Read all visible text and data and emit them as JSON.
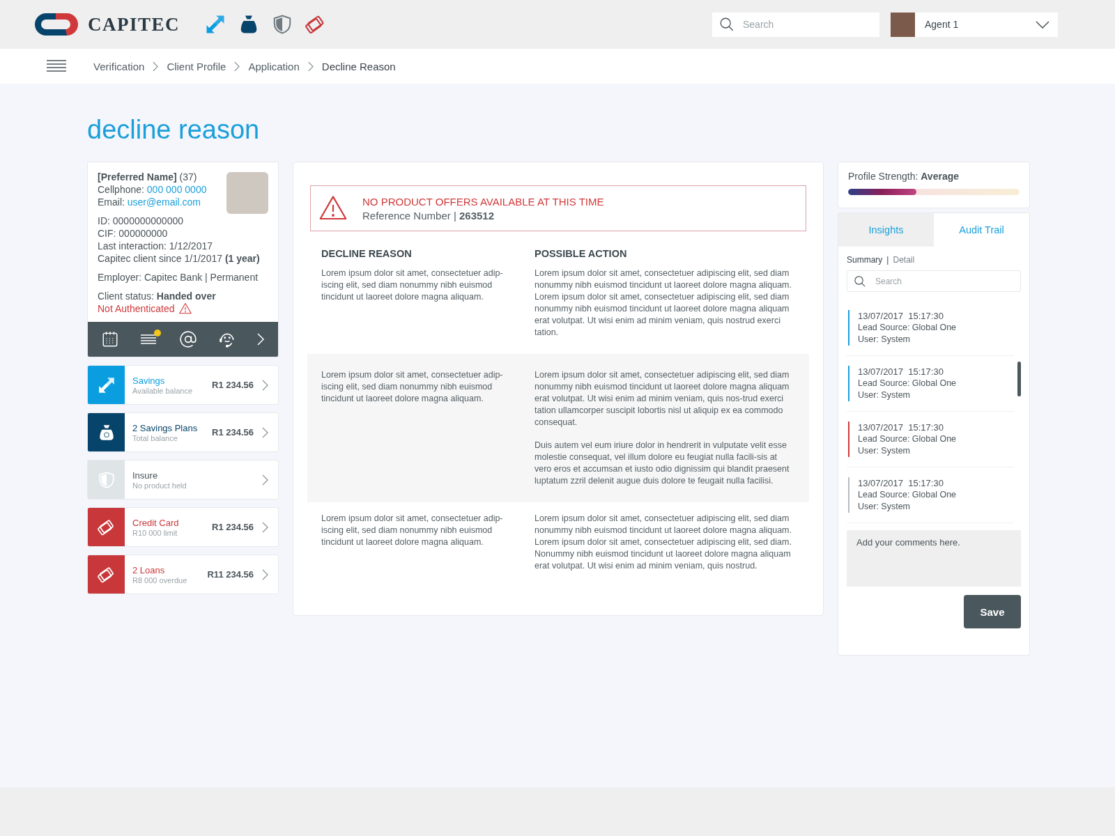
{
  "header": {
    "brand": "CAPITEC",
    "search": {
      "placeholder": "Search"
    },
    "user": {
      "name": "Agent 1"
    }
  },
  "header_icons": [
    {
      "kind": "transfer"
    },
    {
      "kind": "bag"
    },
    {
      "kind": "shield"
    },
    {
      "kind": "card"
    }
  ],
  "breadcrumb": [
    "Verification",
    "Client Profile",
    "Application",
    "Decline Reason"
  ],
  "title": "decline reason",
  "client": {
    "name_line": "**[Preferred Name]** (37)",
    "cellphone_label": "Cellphone:",
    "cellphone": "000 000 0000",
    "email_label": "Email:",
    "email": "user@email.com",
    "details": [
      "ID: 0000000000000",
      "CIF: 000000000",
      "Last interaction: 1/12/2017",
      "Capitec client since 1/1/2017 **(1 year)**"
    ],
    "employer": "Employer: Capitec Bank | Permanent",
    "status": "Client status: **Handed over**",
    "auth": "Not Authenticated"
  },
  "client_actions": [
    {
      "kind": "calendar",
      "alert": false
    },
    {
      "kind": "notes",
      "alert": true
    },
    {
      "kind": "email",
      "alert": false
    },
    {
      "kind": "support",
      "alert": false
    },
    {
      "kind": "more",
      "alert": false
    }
  ],
  "products": [
    {
      "kind": "transfer",
      "title": "Savings",
      "subtitle": "Available balance",
      "amount": "R1 234.56",
      "color": "#0a9ee0",
      "held": true
    },
    {
      "kind": "bag",
      "title": "2 Savings Plans",
      "subtitle": "Total balance",
      "amount": "R1 234.56",
      "color": "#07446b",
      "held": true
    },
    {
      "kind": "shield",
      "title": "Insure",
      "subtitle": "No product held",
      "color": "#dfe4e7",
      "held": false
    },
    {
      "kind": "card",
      "title": "Credit Card",
      "subtitle": "R10 000 limit",
      "amount": "R1 234.56",
      "color": "#c8373a",
      "held": true
    },
    {
      "kind": "card",
      "title": "2 Loans",
      "subtitle": "R8 000 overdue",
      "amount": "R11 234.56",
      "color": "#c8373a",
      "held": true
    }
  ],
  "alert": {
    "title": "NO PRODUCT OFFERS AVAILABLE AT THIS TIME",
    "reference": "Reference Number | **263512**"
  },
  "columns": [
    "DECLINE REASON",
    "POSSIBLE ACTION"
  ],
  "rows": [
    {
      "shaded": false,
      "reason": "Lorem ipsum dolor sit amet, consectetuer adip-iscing elit, sed diam nonummy nibh euismod tincidunt ut laoreet dolore magna aliquam.",
      "actions": [
        "Lorem ipsum dolor sit amet, consectetuer adipiscing elit, sed diam nonummy nibh euismod tincidunt ut laoreet dolore magna aliquam. Lorem ipsum dolor sit amet, consectetuer adipiscing elit, sed diam nonummy nibh euismod tincidunt ut laoreet dolore magna aliquam erat volutpat. Ut wisi enim ad minim veniam, quis nostrud exerci tation."
      ]
    },
    {
      "shaded": true,
      "reason": "Lorem ipsum dolor sit amet, consectetuer adip-iscing elit, sed diam nonummy nibh euismod tincidunt ut laoreet dolore magna aliquam.",
      "actions": [
        "Lorem ipsum dolor sit amet, consectetuer adipiscing elit, sed diam nonummy nibh euismod tincidunt ut laoreet dolore magna aliquam erat volutpat. Ut wisi enim ad minim veniam, quis nos-trud exerci tation ullamcorper suscipit lobortis nisl ut aliquip ex ea commodo consequat.",
        "Duis autem vel eum iriure dolor in hendrerit in vulputate velit esse molestie consequat, vel illum dolore eu feugiat nulla facili-sis at vero eros et accumsan et iusto odio dignissim qui blandit praesent luptatum zzril delenit augue duis dolore te feugait nulla facilisi."
      ]
    },
    {
      "shaded": false,
      "reason": "Lorem ipsum dolor sit amet, consectetuer adip-iscing elit, sed diam nonummy nibh euismod tincidunt ut laoreet dolore magna aliquam.",
      "actions": [
        "Lorem ipsum dolor sit amet, consectetuer adipiscing elit, sed diam nonummy nibh euismod tincidunt ut laoreet dolore magna aliquam. Lorem ipsum dolor sit amet, consectetuer adipiscing elit, sed diam. Nonummy nibh euismod tincidunt ut laoreet dolore magna aliquam erat volutpat. Ut wisi enim ad minim veniam, quis nostrud."
      ]
    }
  ],
  "profile_strength": {
    "label": "Profile Strength: **Average**",
    "level": 0.4
  },
  "tabs": [
    {
      "label": "Insights",
      "selected": false
    },
    {
      "label": "Audit Trail",
      "selected": true
    }
  ],
  "views": [
    {
      "label": "Summary",
      "selected": true
    },
    {
      "label": "Detail",
      "selected": false
    }
  ],
  "views_separator": "|",
  "audit_search": {
    "placeholder": "Search"
  },
  "audit": [
    {
      "timestamp": "13/07/2017  15:17:30",
      "source": "Lead Source: Global One",
      "user": "User: System",
      "color": "#1a9fdb"
    },
    {
      "timestamp": "13/07/2017  15:17:30",
      "source": "Lead Source: Global One",
      "user": "User: System",
      "color": "#1a9fdb"
    },
    {
      "timestamp": "13/07/2017  15:17:30",
      "source": "Lead Source: Global One",
      "user": "User: System",
      "color": "#d0393b"
    },
    {
      "timestamp": "13/07/2017  15:17:30",
      "source": "Lead Source: Global One",
      "user": "User: System",
      "color": "#b5bcc0"
    }
  ],
  "comment": {
    "placeholder": "Add your comments here."
  },
  "save": "Save"
}
